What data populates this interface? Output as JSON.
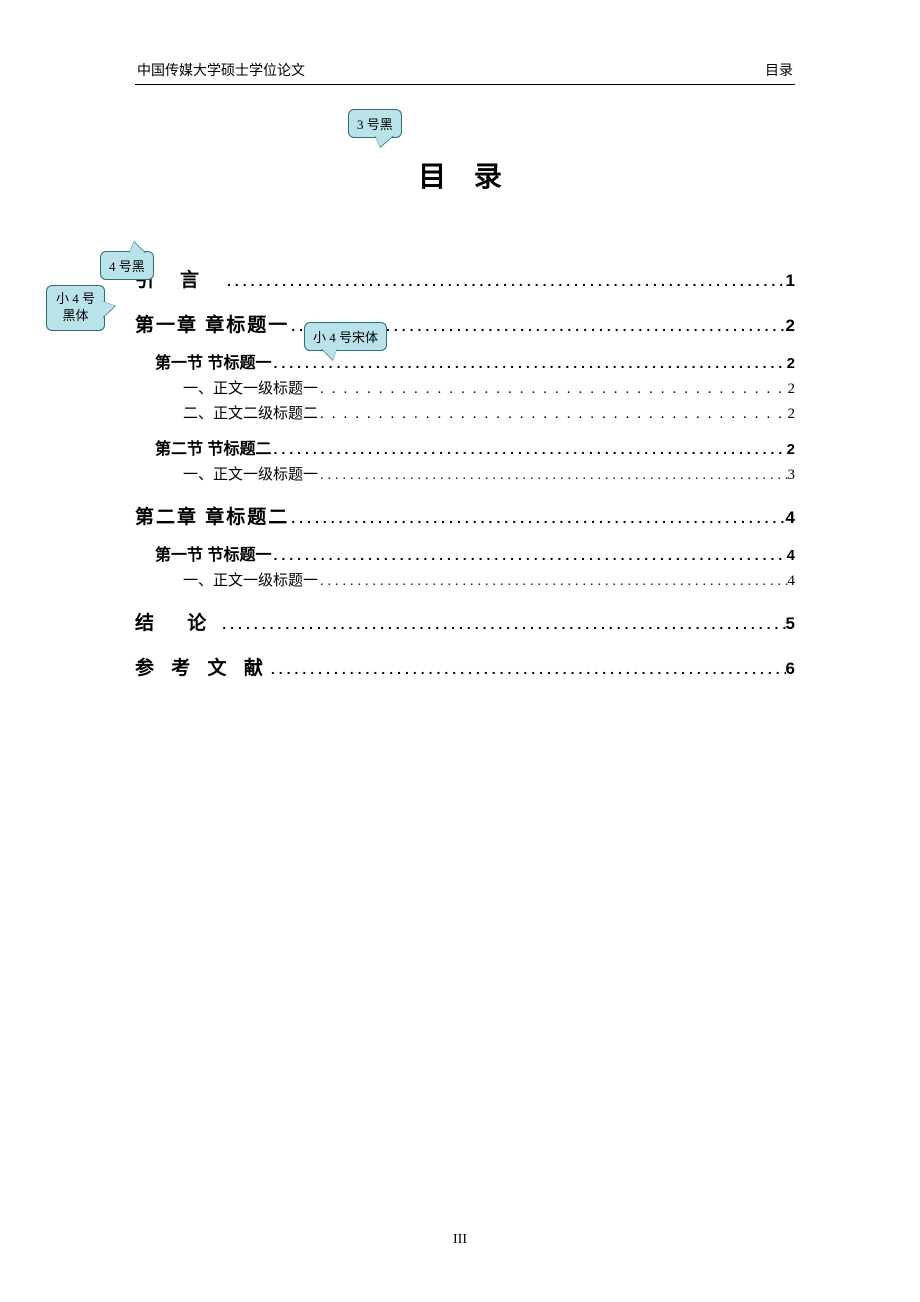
{
  "header": {
    "left": "中国传媒大学硕士学位论文",
    "right": "目录"
  },
  "title": "目 录",
  "callouts": {
    "c1": "3 号黑",
    "c2": "4 号黑",
    "c3_line1": "小 4 号",
    "c3_line2": "黑体",
    "c4": "小 4 号宋体"
  },
  "toc": {
    "intro": {
      "label": "引言",
      "page": "1"
    },
    "ch1": {
      "label": "第一章  章标题一",
      "page": "2",
      "s1": {
        "label": "第一节  节标题一",
        "page": "2",
        "i1": {
          "label": "一、正文一级标题一",
          "page": "2"
        },
        "i2": {
          "label": "二、正文二级标题二",
          "page": "2"
        }
      },
      "s2": {
        "label": "第二节  节标题二",
        "page": "2",
        "i1": {
          "label": "一、正文一级标题一",
          "page": "3"
        }
      }
    },
    "ch2": {
      "label": "第二章  章标题二",
      "page": "4",
      "s1": {
        "label": "第一节  节标题一",
        "page": "4",
        "i1": {
          "label": "一、正文一级标题一",
          "page": "4"
        }
      }
    },
    "jielun": {
      "label": "结 论",
      "page": "5"
    },
    "ckwx": {
      "label": "参 考 文 献",
      "page": "6"
    }
  },
  "dots": "........................................................................................................................",
  "page_number": "III"
}
